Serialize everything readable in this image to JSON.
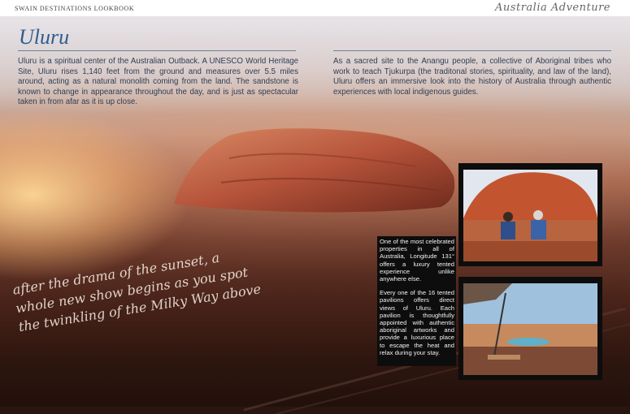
{
  "header": {
    "book_title": "SWAIN DESTINATIONS LOOKBOOK",
    "brand": "Australia Adventure"
  },
  "article": {
    "title": "Uluru",
    "intro_left": "Uluru is a spiritual center of the Australian Outback. A UNESCO World Heritage Site, Uluru rises 1,140 feet from the ground and measures over 5.5 miles around, acting as a natural monolith coming from the land. The sandstone is known to change in appearance throughout the day, and is just as spectacular taken in from afar as it is up close.",
    "intro_right": "As a sacred site to the Anangu people, a collective of Aboriginal tribes who work to teach Tjukurpa (the traditonal stories, spirituality, and law of the land), Uluru offers an immersive look into the history of Australia through authentic experiences with local indigenous guides."
  },
  "sidebar": {
    "para1": "One of the most celebrated properties in all of Australia, Longitude 131° offers a luxury tented experience unlike anywhere else.",
    "para2": "Every one of the 16 tented pavilions offers direct views of Uluru. Each pavilion is thoughtfully appointed with authentic aboriginal artworks and provide a luxurious place to escape the heat and relax during your stay."
  },
  "caption": {
    "line1": "after the drama of the sunset, a",
    "line2": "whole new show begins as you spot",
    "line3": "the twinkling of the Milky Way above"
  },
  "colors": {
    "heading": "#2c5e8e",
    "body_text": "#2e3e52",
    "sidebar_bg": "#0d0d0d"
  }
}
